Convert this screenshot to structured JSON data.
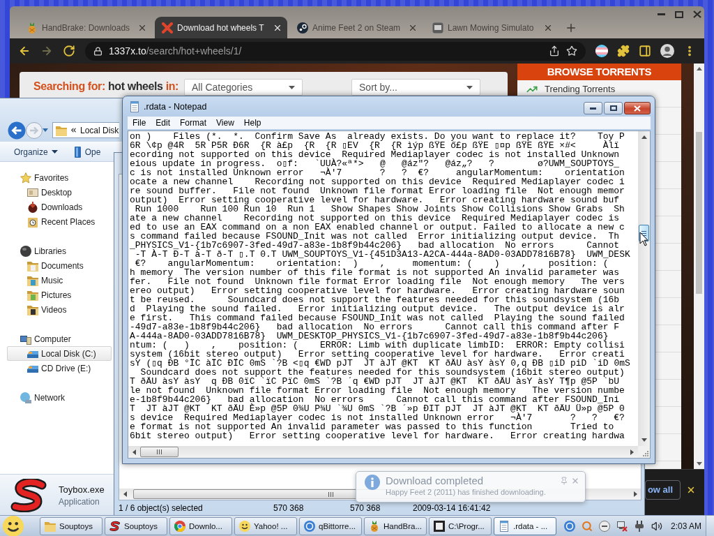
{
  "browser": {
    "tabs": [
      {
        "title": "HandBrake: Downloads",
        "selected": false
      },
      {
        "title": "Download hot wheels T",
        "selected": true
      },
      {
        "title": "Anime Feet 2 on Steam",
        "selected": false
      },
      {
        "title": "Lawn Mowing Simulato",
        "selected": false
      }
    ],
    "address": {
      "host": "1337x.to",
      "path": "/search/hot+wheels/1/"
    },
    "page": {
      "heading": {
        "prefix": "Searching for:",
        "query": "hot wheels",
        "suffix": "in:"
      },
      "category_select": {
        "value": "All Categories"
      },
      "sort_select": {
        "value": "Sort by..."
      },
      "sidebar": {
        "title": "BROWSE TORRENTS",
        "items": [
          "Trending Torrents"
        ]
      }
    },
    "download_bar": {
      "show_all_button": "ow all"
    }
  },
  "explorer": {
    "address": "Local Disk",
    "toolbar": [
      {
        "label": "Organize",
        "kind": "menu"
      },
      {
        "label": "Ope",
        "kind": "action"
      }
    ],
    "navigation": [
      {
        "label": "Favorites",
        "selected": false,
        "children": [
          {
            "label": "Desktop",
            "selected": false
          },
          {
            "label": "Downloads",
            "selected": false
          },
          {
            "label": "Recent Places",
            "selected": false
          }
        ]
      },
      {
        "label": "Libraries",
        "selected": false,
        "children": [
          {
            "label": "Documents",
            "selected": false
          },
          {
            "label": "Music",
            "selected": false
          },
          {
            "label": "Pictures",
            "selected": false
          },
          {
            "label": "Videos",
            "selected": false
          }
        ]
      },
      {
        "label": "Computer",
        "selected": false,
        "children": [
          {
            "label": "Local Disk (C:)",
            "selected": true
          },
          {
            "label": "CD Drive (E:)",
            "selected": false
          }
        ]
      },
      {
        "label": "Network",
        "selected": false
      }
    ],
    "details": {
      "name": "Toybox.exe",
      "type": "Application"
    }
  },
  "file_manager": {
    "status_bar": [
      "1 / 6 object(s) selected",
      "570 368",
      "570 368",
      "2009-03-14 16:41:42"
    ]
  },
  "notepad": {
    "title": ".rdata - Notepad",
    "menu": [
      "File",
      "Edit",
      "Format",
      "View",
      "Help"
    ],
    "lines": [
      "on )    Files (*.  *.  Confirm Save As  already exists. Do you want to replace it?    Toy P",
      "6R \\¢p @4R  5R P5R Ð6R  {R à£p  {R  {R ▯EV  {R  {R ìýp ßŸE ő£p ßŸE ▯¤p ßŸE ßŸE ×#<     Àlï",
      "ecording not supported on this device  Required Mediaplayer codec is not installed Unknown",
      "eious update in progress.  o▯f:   `UUÀ?«ª*>   @   @áz\"?   @áz„?   ?        ø?UWM_SOUPTOYS_",
      "c is not installed Unknown error   ¬À'7       ?   ?  €?     angularMomentum:    orientation",
      "ocate a new channel    Recording not supported on this device  Required Mediaplayer codec i",
      "re sound buffer.   File not found  Unknown file format Error loading file  Not enough memor",
      "output)  Error setting cooperative level for hardware.   Error creating hardware sound buf",
      " Run 1000    Run 100 Run 10  Run 1   Show Shapes Show Joints Show Collisions Show Grabs  Sh",
      "ate a new channel    Recording not supported on this device  Required Mediaplayer codec is",
      "ed to use an EAX command on a non EAX enabled channel or output. Failed to allocate a new c",
      "s command failed because FSOUND_Init was not called  Error initializing output device.  Th",
      "_PHYSICS_V1-{1b7c6907-3fed-49d7-a83e-1b8f9b44c206}   bad allocation  No errors      Cannot",
      " -T À-T Ð-T à-T ð-T ▯.T 0.T UWM_SOUPTOYS_V1-{451D3A13-A2CA-444a-8AD0-03ADD7816B78}  UWM_DESK",
      " €?    angularMomentum:    orientation:  )    ,     momentum: (    )    ,    position: (",
      "h memory  The version number of this file format is not supported An invalid parameter was",
      "fer.   File not found  Unknown file format Error loading file  Not enough memory   The vers",
      "ereo output)   Error setting cooperative level for hardware.   Error creating hardware soun",
      "t be reused.      Soundcard does not support the features needed for this soundsystem (16b",
      "d  Playing the sound failed.   Error initializing output device.   The output device is alr",
      "e first.   This command failed because FSOUND_Init was not called  Playing the sound failed",
      "-49d7-a83e-1b8f9b44c206}   bad allocation  No errors      Cannot call this command after F",
      "A-444a-8AD0-03ADD7816B78}  UWM_DESKTOP_PHYSICS_V1-{1b7c6907-3fed-49d7-a83e-1b8f9b44c206}",
      "ntum: (   )    ,    position: (    ERROR: Limb with duplicate limbID:  ERROR: Empty collisi",
      "system (16bit stereo output)   Error setting cooperative level for hardware.   Error creati",
      "sY (▯q ÐB °ÏC àÏC ÐÏC 0mS `?B <▯q €WD pJT  JT àJT @KT  KT ðÄU àsY àsY 0,q ÐB ▯iD piD `iD 0mS",
      "  Soundcard does not support the features needed for this soundsystem (16bit stereo output)",
      "T ðÄU àsY àsY  q ÐB 0ïC `ïC PïC 0mS `?B ´q €WD pJT  JT àJT @KT  KT ðÄU àsY àsY T¶p @5P `bU",
      "le not found  Unknown file format Error loading file  Not enough memory   The version numbe",
      "e-1b8f9b44c206}   bad allocation  No errors      Cannot call this command after FSOUND_Ini",
      "T  JT àJT @KT  KT ðÄU È»p @5P 0¾U P¾U `¾U 0mS `?B ´»p ÐIT pJT  JT àJT @KT  KT ðÄU Ü»p @5P 0",
      "s device  Required Mediaplayer codec is not installed Unknown error   ¬À'7       ?   ?   €?",
      "e format is not supported An invalid parameter was passed to this function       Tried to",
      "6bit stereo output)   Error setting cooperative level for hardware.   Error creating hardwa"
    ]
  },
  "notification": {
    "title": "Download completed",
    "message": "Happy Feet 2 (2011) has finished downloading."
  },
  "taskbar": {
    "buttons": [
      {
        "label": "Souptoys",
        "selected": false
      },
      {
        "label": "Souptoys",
        "selected": false
      },
      {
        "label": "Downlo...",
        "selected": false
      },
      {
        "label": "Yahoo! ...",
        "selected": false
      },
      {
        "label": "qBittorre...",
        "selected": false
      },
      {
        "label": "HandBra...",
        "selected": false
      },
      {
        "label": "C:\\Progr...",
        "selected": false
      },
      {
        "label": ".rdata - ...",
        "selected": true
      }
    ],
    "clock": "2:03 AM"
  }
}
